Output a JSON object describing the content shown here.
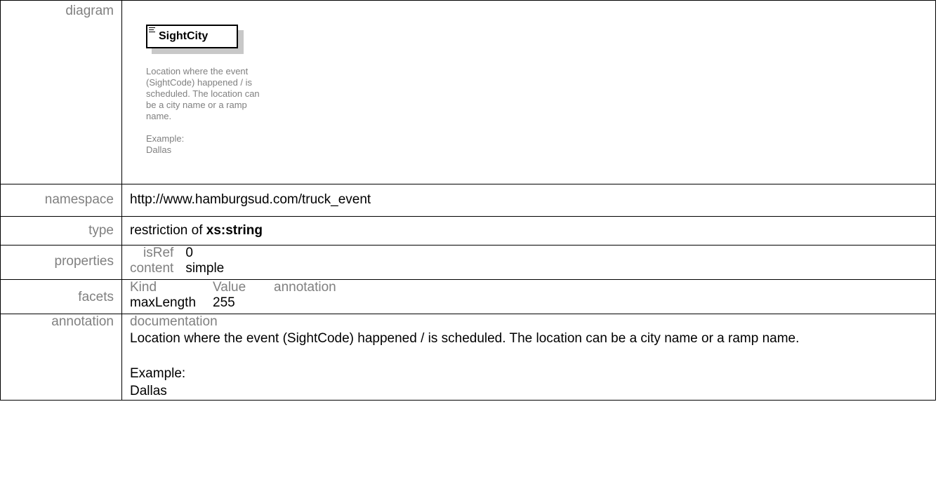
{
  "rows": {
    "diagram": {
      "label": "diagram"
    },
    "namespace": {
      "label": "namespace",
      "value": "http://www.hamburgsud.com/truck_event"
    },
    "type": {
      "label": "type",
      "prefix": "restriction of ",
      "base": "xs:string"
    },
    "properties": {
      "label": "properties",
      "items": [
        {
          "key": "isRef",
          "value": "0"
        },
        {
          "key": "content",
          "value": "simple"
        }
      ]
    },
    "facets": {
      "label": "facets",
      "headers": [
        "Kind",
        "Value",
        "annotation"
      ],
      "rows": [
        {
          "kind": "maxLength",
          "value": "255",
          "annotation": ""
        }
      ]
    },
    "annotation": {
      "label": "annotation",
      "heading": "documentation",
      "text": "Location where the event (SightCode) happened / is scheduled. The location can be a city name or a ramp name.\n\nExample:\nDallas"
    }
  },
  "diagram_node": {
    "name": "SightCity",
    "icon": "element-lines-icon",
    "doc": "Location where the event\n(SightCode) happened / is\nscheduled. The location can\nbe a city name or a ramp\nname.\n\nExample:\nDallas"
  }
}
